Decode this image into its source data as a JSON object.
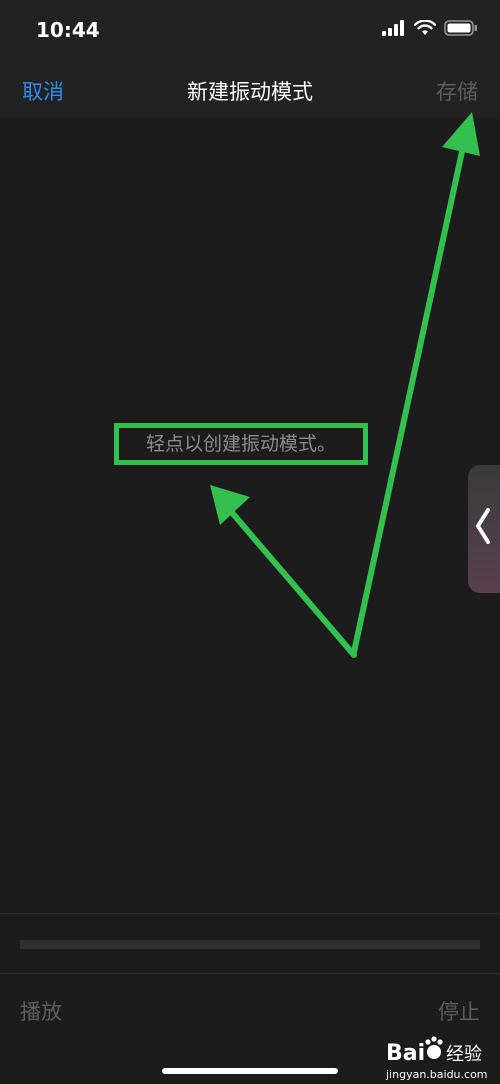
{
  "status_bar": {
    "time": "10:44",
    "icons": [
      "cellular-signal-icon",
      "wifi-icon",
      "battery-icon"
    ]
  },
  "nav": {
    "cancel_label": "取消",
    "title": "新建振动模式",
    "save_label": "存储"
  },
  "canvas": {
    "hint": "轻点以创建振动模式。"
  },
  "side_tab_icon": "chevron-left-icon",
  "playback": {
    "progress": 0
  },
  "bottom": {
    "play_label": "播放",
    "stop_label": "停止"
  },
  "watermark": {
    "brand": "Bai",
    "brand_suffix": "经验",
    "url": "jingyan.baidu.com"
  },
  "colors": {
    "accent": "#2f8cf0",
    "annotation": "#33c04e",
    "disabled": "#5d5d5d"
  }
}
